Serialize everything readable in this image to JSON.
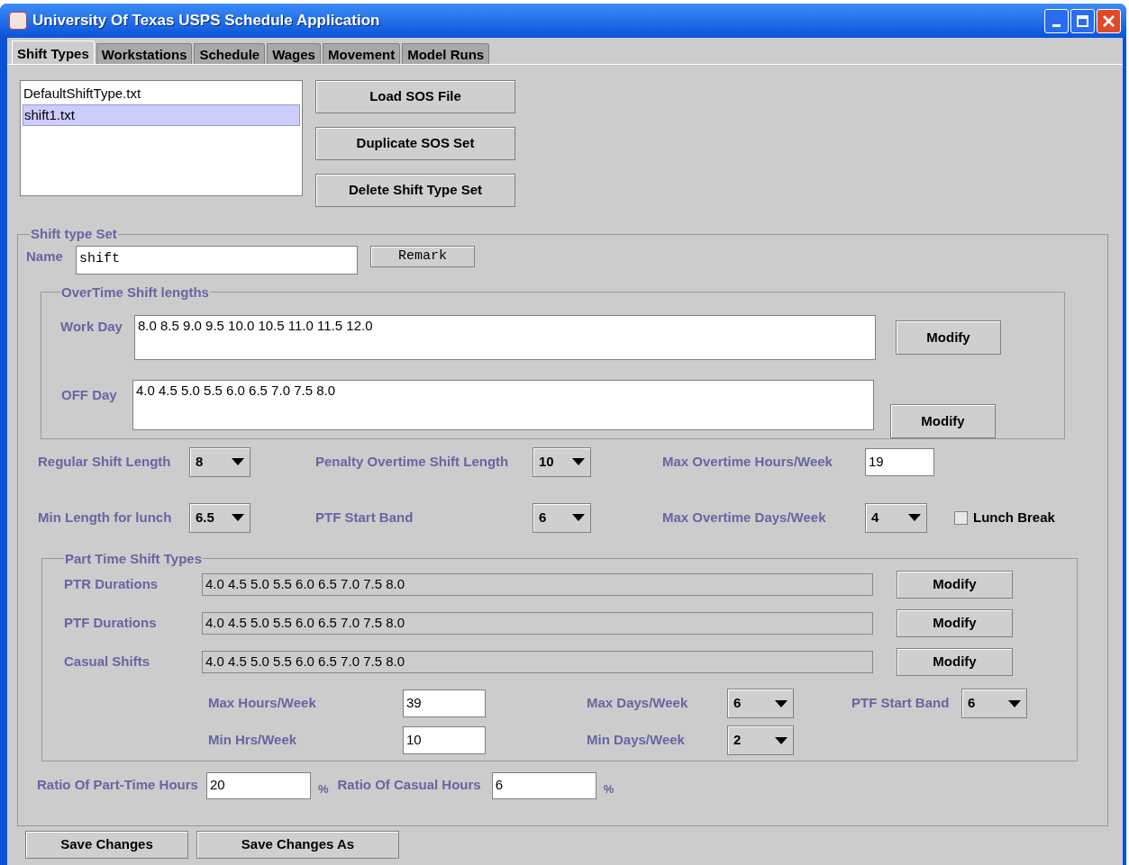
{
  "window": {
    "title": "University Of Texas USPS Schedule Application"
  },
  "tabs": [
    {
      "label": "Shift Types",
      "selected": true
    },
    {
      "label": "Workstations",
      "selected": false
    },
    {
      "label": "Schedule",
      "selected": false
    },
    {
      "label": "Wages",
      "selected": false
    },
    {
      "label": "Movement",
      "selected": false
    },
    {
      "label": "Model Runs",
      "selected": false
    }
  ],
  "files": [
    {
      "label": "DefaultShiftType.txt",
      "selected": false
    },
    {
      "label": "shift1.txt",
      "selected": true
    }
  ],
  "file_buttons": [
    "Load SOS File",
    "Duplicate SOS Set",
    "Delete Shift Type Set"
  ],
  "shift_type_set": {
    "legend": "Shift type Set",
    "name_label": "Name",
    "name_value": "shift",
    "remark_button": "Remark",
    "overtime": {
      "legend": "OverTime Shift lengths",
      "rows": [
        {
          "label": "Work Day",
          "value": "8.0 8.5 9.0 9.5 10.0 10.5 11.0 11.5 12.0",
          "button": "Modify"
        },
        {
          "label": "OFF Day",
          "value": "4.0 4.5 5.0 5.5 6.0 6.5 7.0 7.5 8.0",
          "button": "Modify"
        }
      ]
    },
    "settings": [
      [
        {
          "kind": "dropdown",
          "label": "Regular Shift Length",
          "value": "8"
        },
        {
          "kind": "dropdown",
          "label": "Penalty Overtime Shift Length",
          "value": "10"
        },
        {
          "kind": "field",
          "label": "Max Overtime Hours/Week",
          "value": "19"
        }
      ],
      [
        {
          "kind": "dropdown",
          "label": "Min Length for lunch",
          "value": "6.5"
        },
        {
          "kind": "dropdown",
          "label": "PTF Start Band",
          "value": "6"
        },
        {
          "kind": "dropdown",
          "label": "Max Overtime Days/Week",
          "value": "4"
        },
        {
          "kind": "checkbox",
          "label": "Lunch Break",
          "checked": false
        }
      ]
    ],
    "part_time": {
      "legend": "Part Time Shift Types",
      "rows": [
        {
          "label": "PTR Durations",
          "value": "4.0 4.5 5.0 5.5 6.0 6.5 7.0 7.5 8.0",
          "button": "Modify"
        },
        {
          "label": "PTF Durations",
          "value": "4.0 4.5 5.0 5.5 6.0 6.5 7.0 7.5 8.0",
          "button": "Modify"
        },
        {
          "label": "Casual Shifts",
          "value": "4.0 4.5 5.0 5.5 6.0 6.5 7.0 7.5 8.0",
          "button": "Modify"
        }
      ],
      "limits": [
        [
          {
            "kind": "field",
            "label": "Max Hours/Week",
            "value": "39"
          },
          {
            "kind": "dropdown",
            "label": "Max Days/Week",
            "value": "6"
          },
          {
            "kind": "dropdown",
            "label": "PTF Start Band",
            "value": "6"
          }
        ],
        [
          {
            "kind": "field",
            "label": "Min Hrs/Week",
            "value": "10"
          },
          {
            "kind": "dropdown",
            "label": "Min Days/Week",
            "value": "2"
          }
        ]
      ]
    },
    "ratios": [
      {
        "label": "Ratio Of Part-Time Hours",
        "value": "20",
        "unit": "%"
      },
      {
        "label": "Ratio Of Casual Hours",
        "value": "6",
        "unit": "%"
      }
    ]
  },
  "bottom_buttons": [
    "Save Changes",
    "Save Changes As"
  ]
}
